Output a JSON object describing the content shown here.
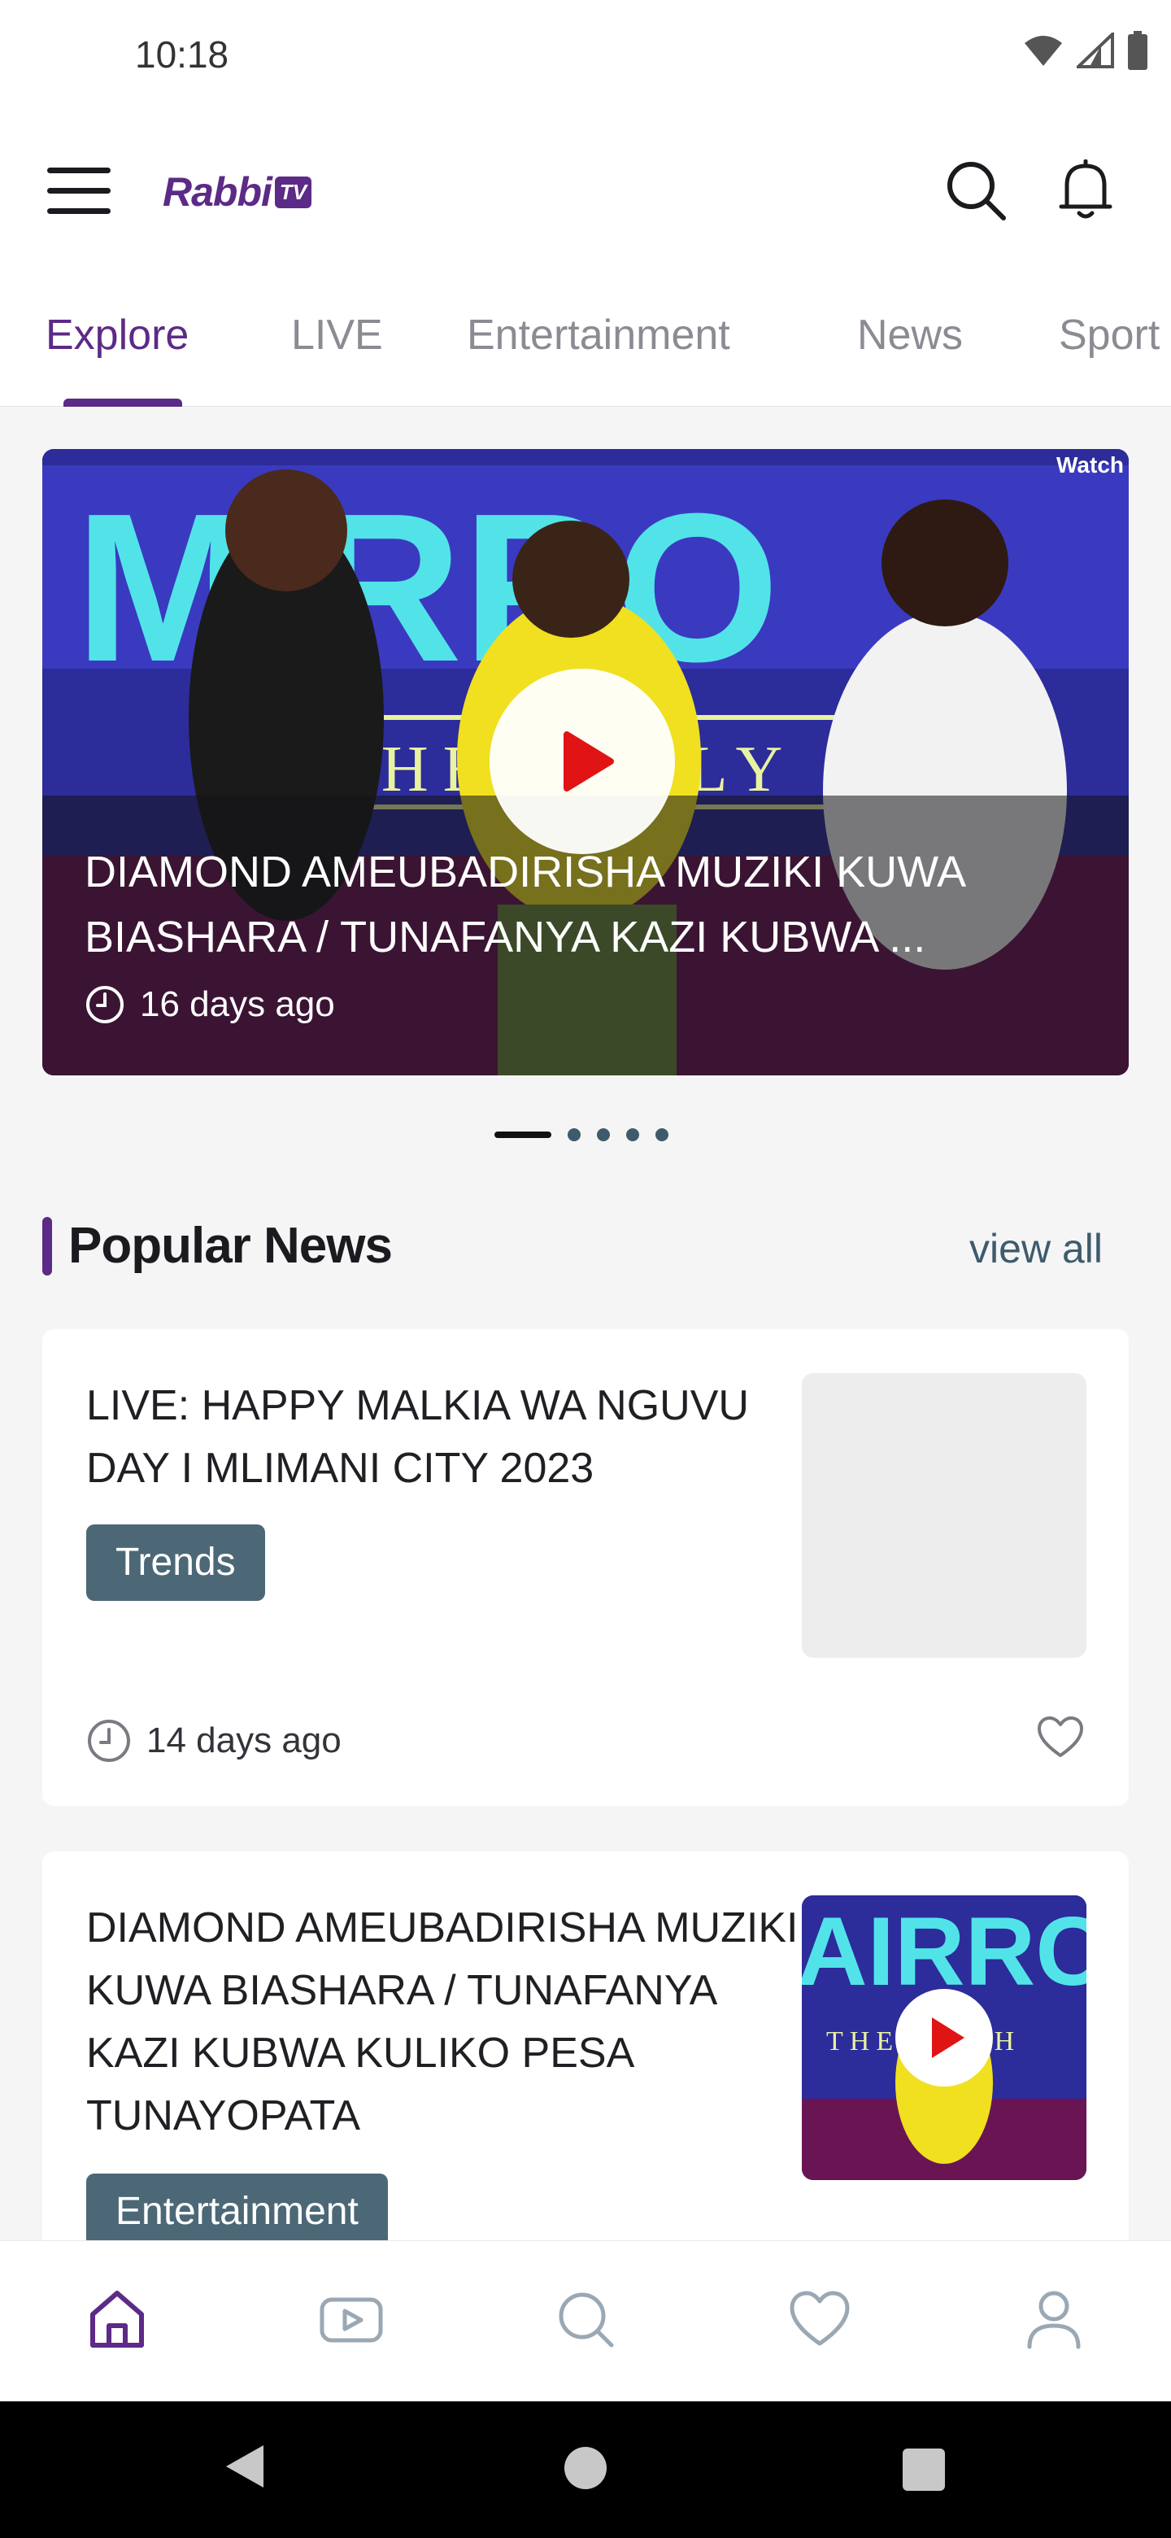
{
  "status_bar": {
    "time": "10:18",
    "icons": [
      "wifi-icon",
      "cell-signal-icon",
      "battery-icon"
    ]
  },
  "header": {
    "logo_text": "Rabbi",
    "logo_badge": "TV",
    "icons": [
      "menu-icon",
      "search-icon",
      "bell-icon"
    ]
  },
  "tabs": [
    {
      "label": "Explore",
      "active": true
    },
    {
      "label": "LIVE",
      "active": false
    },
    {
      "label": "Entertainment",
      "active": false
    },
    {
      "label": "News",
      "active": false
    },
    {
      "label": "Sport",
      "active": false
    }
  ],
  "hero": {
    "watch_label": "Watch",
    "title": "DIAMOND AMEUBADIRISHA MUZIKI KUWA BIASHARA / TUNAFANYA KAZI KUBWA ...",
    "time": "16 days ago",
    "slide_count": 5,
    "active_slide": 1
  },
  "popular_news": {
    "title": "Popular News",
    "view_all": "view all",
    "items": [
      {
        "title": "LIVE: HAPPY MALKIA WA NGUVU DAY I MLIMANI CITY 2023",
        "tag": "Trends",
        "time": "14 days ago",
        "has_image": false
      },
      {
        "title": "DIAMOND AMEUBADIRISHA MUZIKI KUWA BIASHARA / TUNAFANYA KAZI KUBWA KULIKO PESA TUNAYOPATA",
        "tag": "Entertainment",
        "has_image": true
      }
    ]
  },
  "bottom_nav": {
    "items": [
      "home-icon",
      "video-icon",
      "search-icon",
      "heart-icon",
      "profile-icon"
    ],
    "active": "home-icon"
  },
  "colors": {
    "brand": "#5c2a87",
    "tag": "#4c6877",
    "play_red": "#e01414"
  }
}
